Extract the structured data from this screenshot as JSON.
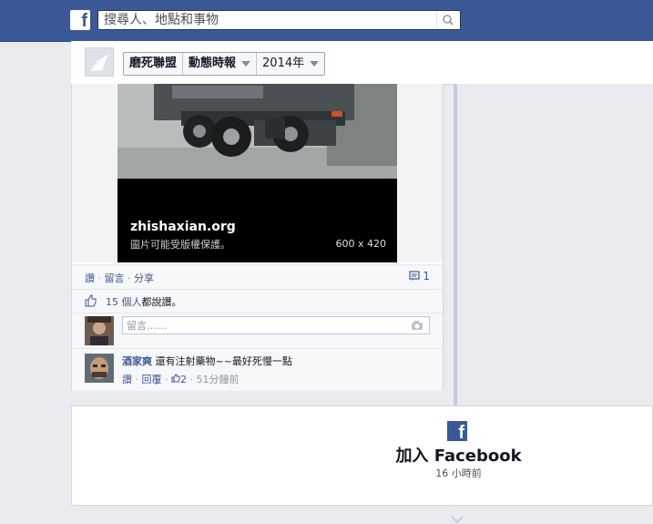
{
  "header": {
    "logo": "f",
    "search_placeholder": "搜尋人、地點和事物",
    "search_icon": "search-icon"
  },
  "timeline_bar": {
    "breadcrumbs": [
      {
        "label": "磨死聯盟"
      },
      {
        "label": "動態時報"
      },
      {
        "label": "2014年"
      }
    ]
  },
  "post": {
    "photo": {
      "site": "zhishaxian.org",
      "copyright": "圖片可能受版權保護。",
      "dimensions": "600 x 420"
    },
    "actions": {
      "like": "讚",
      "comment": "留言",
      "share": "分享",
      "sep": "·",
      "comment_count": "1"
    },
    "likes": {
      "count_text": "15 個人",
      "suffix": "都說讚。"
    },
    "comment_input": {
      "placeholder": "留言……"
    },
    "comment": {
      "author": "酒家爽",
      "text": "還有注射藥物~~最好死慢一點",
      "like": "讚",
      "reply": "回覆",
      "likes_count": "2",
      "time": "51分鐘前"
    }
  },
  "join_card": {
    "title": "加入 Facebook",
    "subtitle": "16 小時前"
  },
  "colors": {
    "brand": "#3b5998",
    "background": "#e9ebee",
    "link": "#3b5998"
  }
}
